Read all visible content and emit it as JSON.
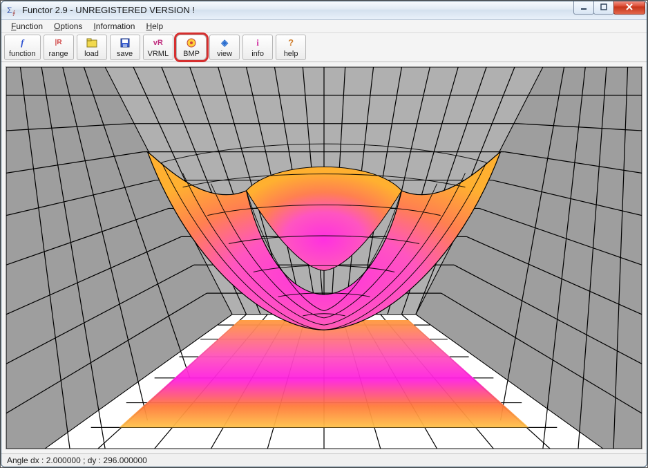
{
  "window": {
    "title": "Functor 2.9 - UNREGISTERED VERSION !"
  },
  "menu": {
    "function": "Function",
    "options": "Options",
    "information": "Information",
    "help": "Help"
  },
  "toolbar": {
    "function": "function",
    "range": "range",
    "load": "load",
    "save": "save",
    "vrml": "VRML",
    "bmp": "BMP",
    "view": "view",
    "info": "info",
    "help": "help"
  },
  "status": {
    "text": "Angle dx : 2.000000 ; dy : 296.000000"
  },
  "chart_data": {
    "type": "surface3d",
    "function": "z = x^2 + y^2 (paraboloid-like bowl surface)",
    "grid_resolution": 12,
    "view_angle": {
      "dx": 2.0,
      "dy": 296.0
    },
    "colormap": "orange-pink-magenta height gradient",
    "axes_box": true,
    "floor_projection": true
  }
}
